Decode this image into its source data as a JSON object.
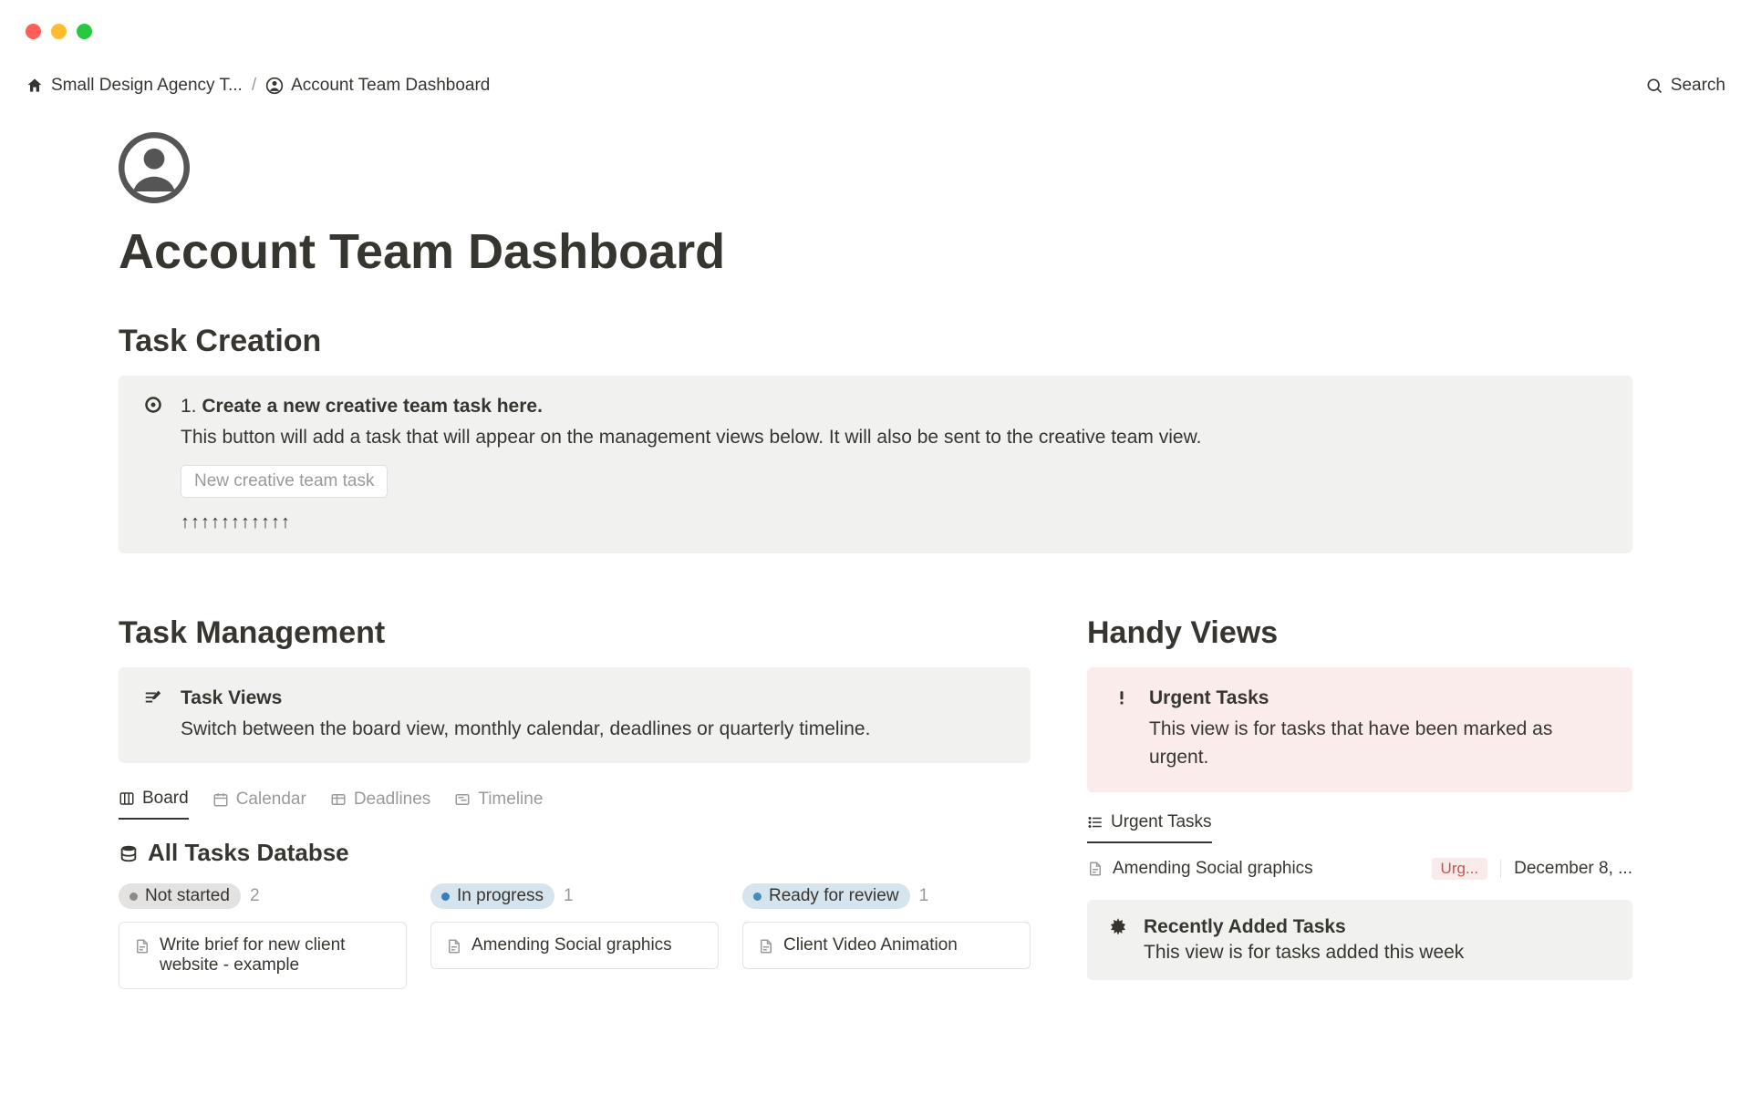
{
  "breadcrumb": {
    "root": "Small Design Agency T...",
    "current": "Account Team Dashboard"
  },
  "search_label": "Search",
  "page_title": "Account Team Dashboard",
  "sections": {
    "task_creation": {
      "heading": "Task Creation",
      "callout": {
        "step_num": "1.",
        "step_title": "Create a new creative team task here.",
        "description": "This button will add a task that will appear on the management views below. It will also be sent to the creative team view.",
        "button_label": "New creative team task",
        "arrows": "↑↑↑↑↑↑↑↑↑↑↑"
      }
    },
    "task_management": {
      "heading": "Task Management",
      "callout": {
        "title": "Task Views",
        "description": "Switch between the board view, monthly calendar, deadlines or quarterly timeline."
      },
      "tabs": [
        {
          "label": "Board",
          "active": true
        },
        {
          "label": "Calendar",
          "active": false
        },
        {
          "label": "Deadlines",
          "active": false
        },
        {
          "label": "Timeline",
          "active": false
        }
      ],
      "database_title": "All Tasks Databse",
      "board": {
        "columns": [
          {
            "status": "Not started",
            "count": "2",
            "pill_class": "pill-grey",
            "dot_class": "dot-grey",
            "cards": [
              "Write brief for new client website - example"
            ]
          },
          {
            "status": "In progress",
            "count": "1",
            "pill_class": "pill-blue",
            "dot_class": "dot-blue",
            "cards": [
              "Amending Social graphics"
            ]
          },
          {
            "status": "Ready for review",
            "count": "1",
            "pill_class": "pill-blue",
            "dot_class": "dot-teal",
            "cards": [
              "Client Video Animation"
            ]
          }
        ]
      }
    },
    "handy_views": {
      "heading": "Handy Views",
      "urgent_callout": {
        "title": "Urgent Tasks",
        "description": "This view is for tasks that have been marked as urgent."
      },
      "urgent_tab": "Urgent Tasks",
      "urgent_items": [
        {
          "title": "Amending Social graphics",
          "badge": "Urg...",
          "date": "December 8, ..."
        }
      ],
      "recent_callout": {
        "title": "Recently Added Tasks",
        "description": "This view is for tasks added this week"
      }
    }
  }
}
